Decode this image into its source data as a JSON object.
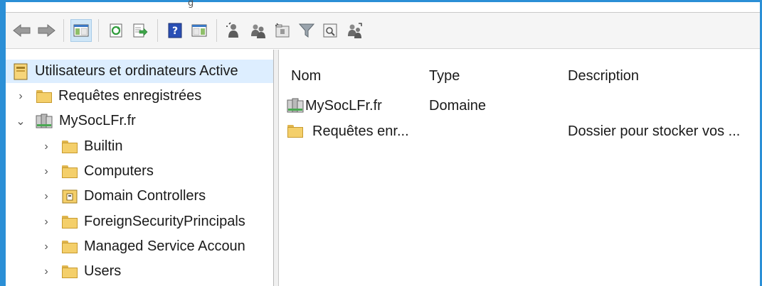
{
  "window": {
    "title_fragment": "g"
  },
  "toolbar": {
    "buttons": [
      {
        "name": "back-arrow-icon"
      },
      {
        "name": "forward-arrow-icon"
      },
      {
        "name": "show-hide-console-tree-icon",
        "active": true
      },
      {
        "name": "refresh-icon"
      },
      {
        "name": "export-list-icon"
      },
      {
        "name": "help-icon"
      },
      {
        "name": "show-hide-action-pane-icon"
      },
      {
        "name": "create-user-icon"
      },
      {
        "name": "create-group-icon"
      },
      {
        "name": "create-ou-icon"
      },
      {
        "name": "filter-icon"
      },
      {
        "name": "find-icon"
      },
      {
        "name": "add-to-group-icon"
      }
    ]
  },
  "tree": {
    "root": {
      "label": "Utilisateurs et ordinateurs Active",
      "icon": "ad-console-root-icon"
    },
    "items": [
      {
        "label": "Requêtes enregistrées",
        "icon": "folder-icon",
        "expanded": false,
        "level": 1
      },
      {
        "label": "MySocLFr.fr",
        "icon": "domain-icon",
        "expanded": true,
        "level": 1
      },
      {
        "label": "Builtin",
        "icon": "folder-icon",
        "expanded": false,
        "level": 2
      },
      {
        "label": "Computers",
        "icon": "folder-icon",
        "expanded": false,
        "level": 2
      },
      {
        "label": "Domain Controllers",
        "icon": "ou-folder-icon",
        "expanded": false,
        "level": 2
      },
      {
        "label": "ForeignSecurityPrincipals",
        "icon": "folder-icon",
        "expanded": false,
        "level": 2
      },
      {
        "label": "Managed Service Accoun",
        "icon": "folder-icon",
        "expanded": false,
        "level": 2
      },
      {
        "label": "Users",
        "icon": "folder-icon",
        "expanded": false,
        "level": 2
      }
    ]
  },
  "list": {
    "columns": [
      "Nom",
      "Type",
      "Description"
    ],
    "rows": [
      {
        "name": "MySocLFr.fr",
        "type": "Domaine",
        "description": "",
        "icon": "domain-icon"
      },
      {
        "name": "Requêtes enr...",
        "type": "",
        "description": "Dossier pour stocker vos ...",
        "icon": "folder-icon"
      }
    ]
  },
  "colors": {
    "window_border": "#2b8fd6",
    "selection": "#ddeeff",
    "folder": "#f4cf6a"
  }
}
